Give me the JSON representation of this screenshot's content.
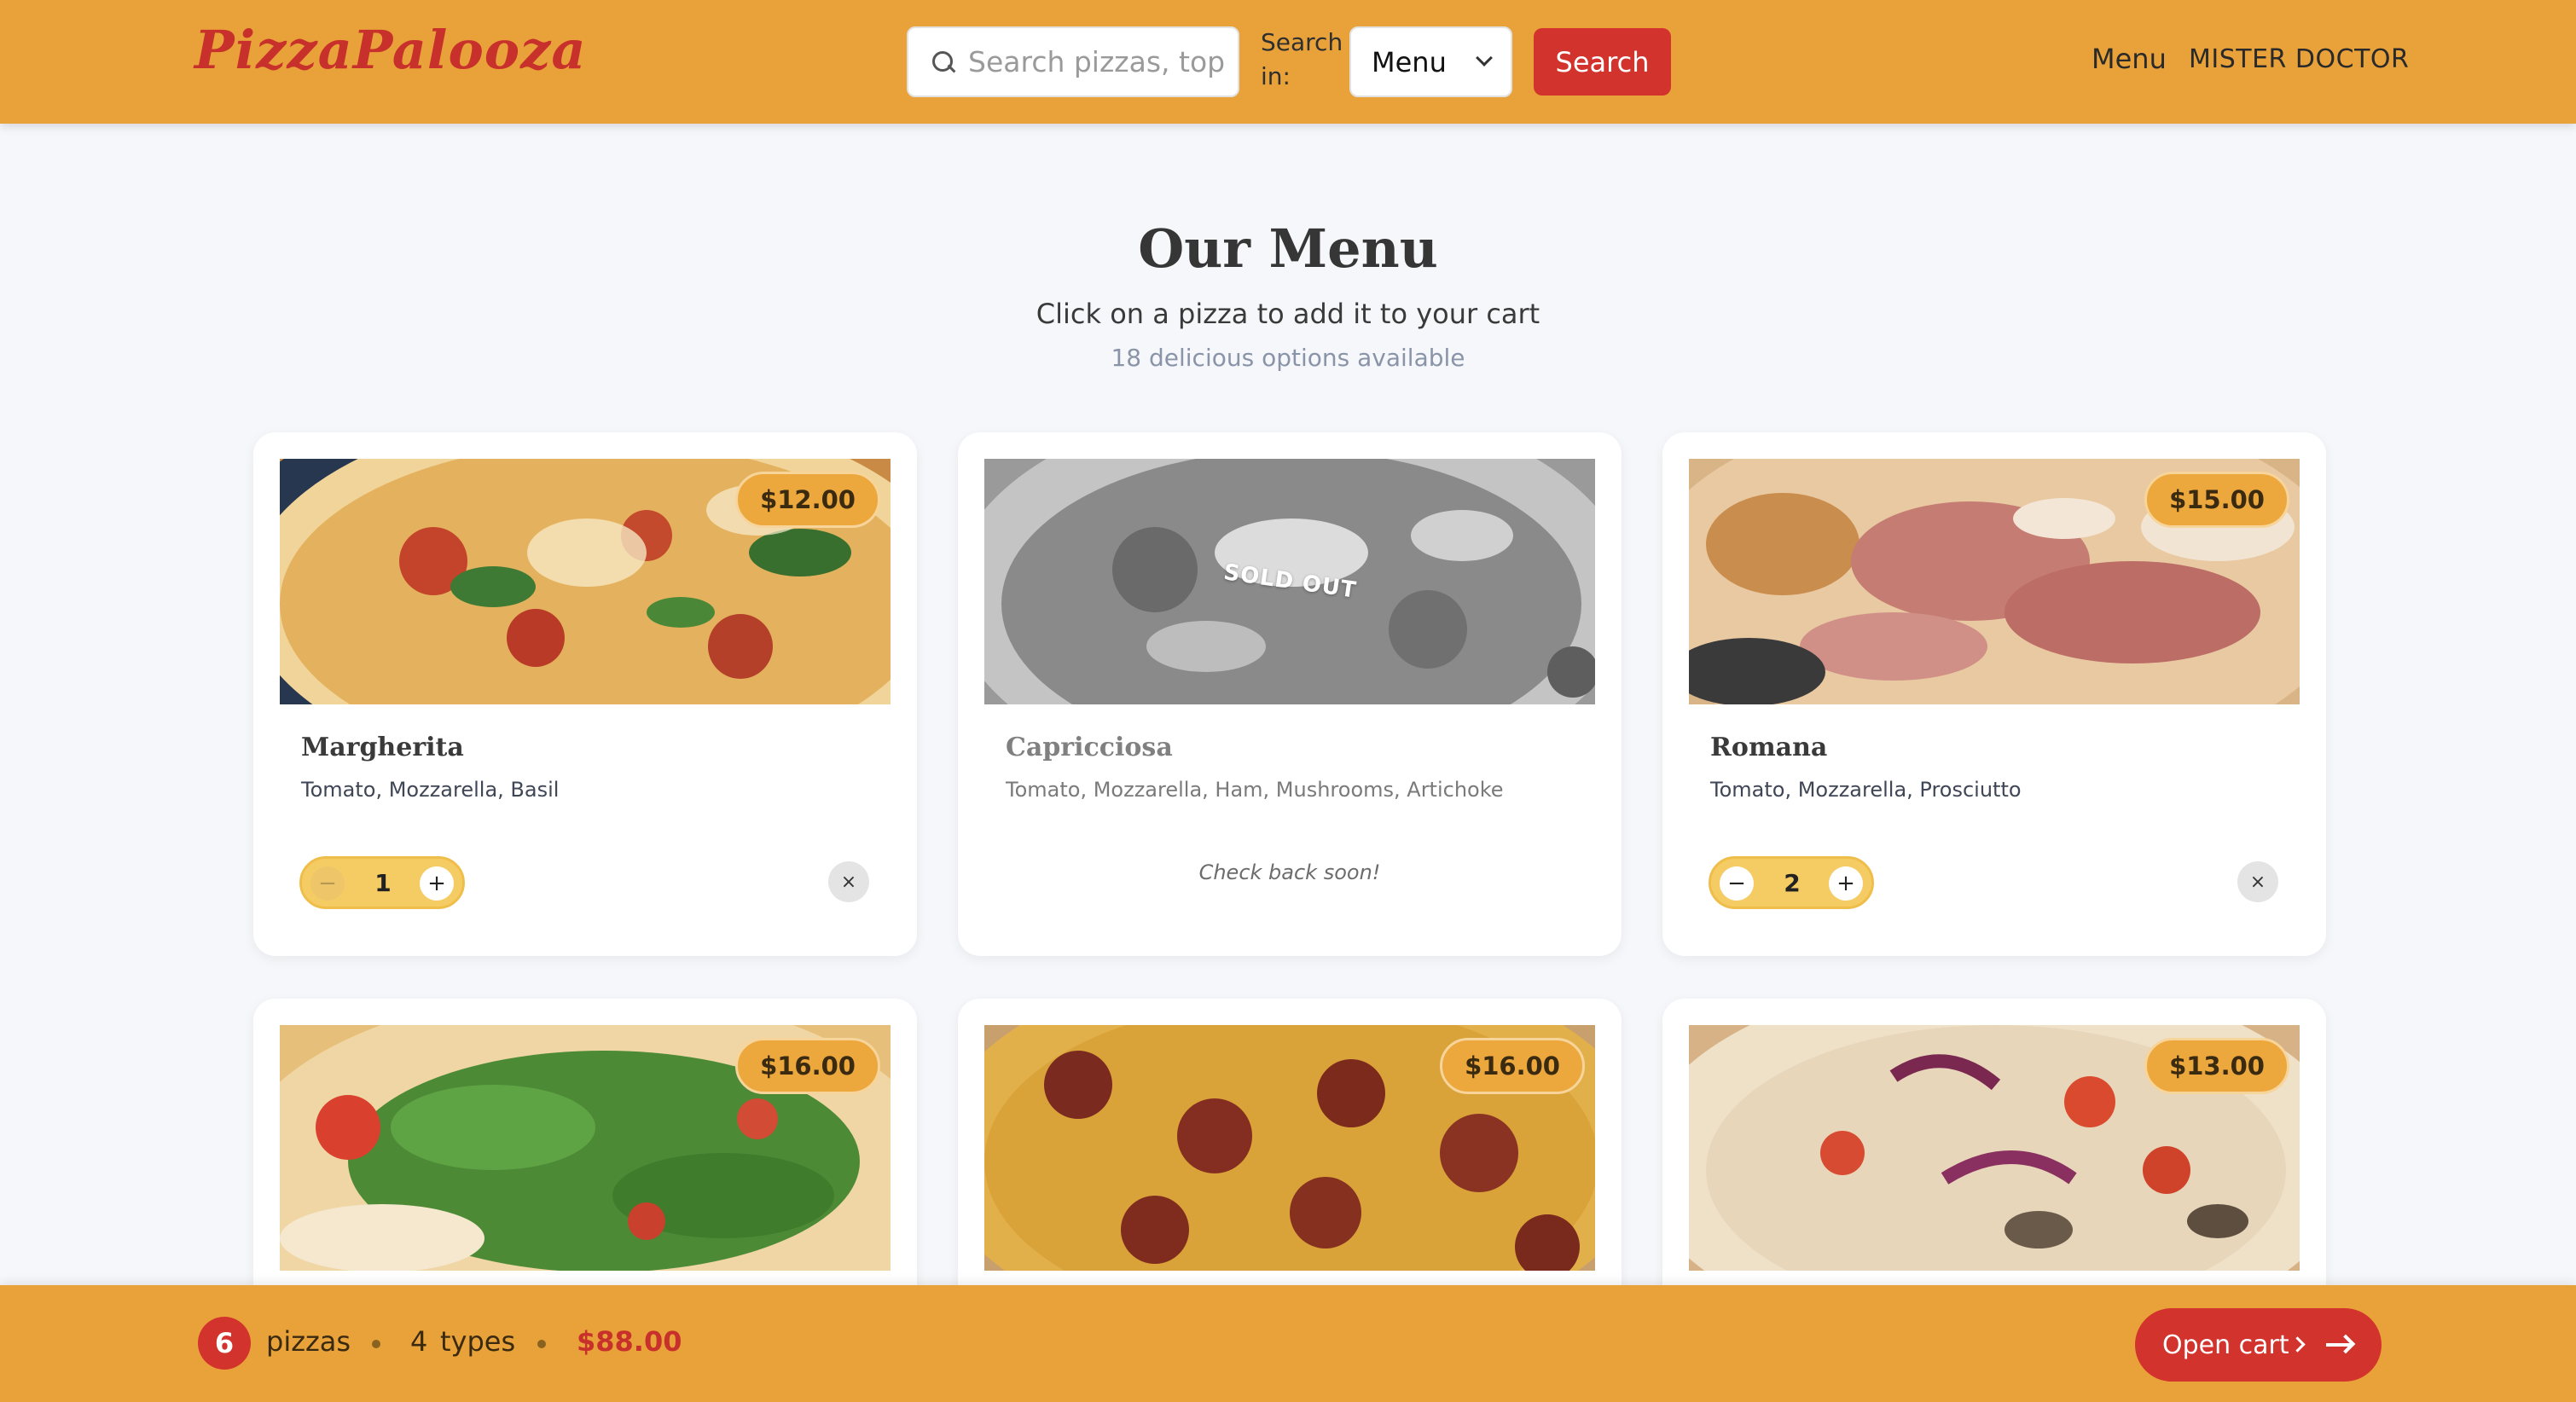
{
  "header": {
    "logo": "PizzaPalooza",
    "search_placeholder": "Search pizzas, toppings...",
    "search_in_label": "Search in:",
    "search_scope": "Menu",
    "search_button": "Search",
    "nav_menu": "Menu",
    "nav_user": "MISTER DOCTOR"
  },
  "main": {
    "title": "Our Menu",
    "subtitle": "Click on a pizza to add it to your cart",
    "count_text": "18 delicious options available"
  },
  "pizzas": [
    {
      "name": "Margherita",
      "ingredients": "Tomato, Mozzarella, Basil",
      "price": "$12.00",
      "quantity": "1",
      "sold_out": false
    },
    {
      "name": "Capricciosa",
      "ingredients": "Tomato, Mozzarella, Ham, Mushrooms, Artichoke",
      "price": "",
      "sold_out": true,
      "sold_out_label": "SOLD OUT",
      "unavailable_note": "Check back soon!"
    },
    {
      "name": "Romana",
      "ingredients": "Tomato, Mozzarella, Prosciutto",
      "price": "$15.00",
      "quantity": "2",
      "sold_out": false
    },
    {
      "price": "$16.00"
    },
    {
      "price": "$16.00"
    },
    {
      "price": "$13.00"
    }
  ],
  "stepper": {
    "minus": "−",
    "plus": "+",
    "remove": "×"
  },
  "cart_bar": {
    "count": "6",
    "pizzas_label": "pizzas",
    "types_count": "4",
    "types_label": "types",
    "total": "$88.00",
    "open_cart": "Open cart"
  },
  "colors": {
    "brand": "#e9a23a",
    "accent": "#d2332c",
    "price_badge": "#eca73d"
  }
}
